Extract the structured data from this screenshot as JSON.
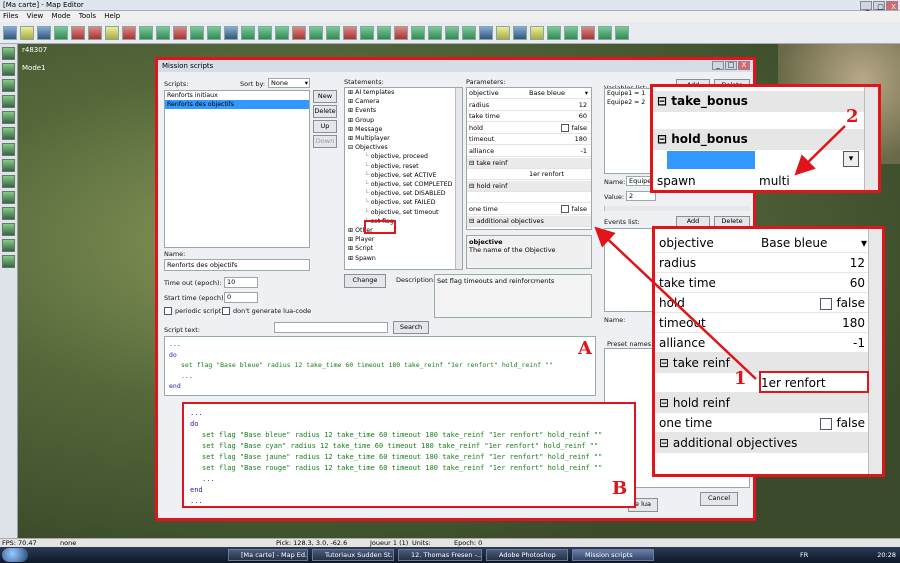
{
  "window": {
    "title": "[Ma carte] - Map Editor",
    "buttons": [
      "_",
      "□",
      "X"
    ]
  },
  "menu": [
    "Files",
    "View",
    "Mode",
    "Tools",
    "Help"
  ],
  "viewport": {
    "coords": "r48307",
    "mode": "Mode1"
  },
  "dialog": {
    "title": "Mission scripts",
    "scripts_label": "Scripts:",
    "sort_label": "Sort by:",
    "sort_value": "None",
    "scripts": [
      "Renforts initiaux",
      "Renforts des objectifs"
    ],
    "selected_script": 1,
    "script_buttons": {
      "new": "New",
      "delete": "Delete",
      "up": "Up",
      "down": "Down"
    },
    "name_label": "Name:",
    "name_value": "Renforts des objectifs",
    "timeout_label": "Time out (epoch):",
    "timeout_value": "10",
    "start_label": "Start time (epoch):",
    "start_value": "0",
    "periodic_label": "periodic script",
    "nolua_label": "don't generate lua-code",
    "script_text_label": "Script text:",
    "search_label": "Search",
    "statements_label": "Statements:",
    "tree": [
      {
        "label": "AI templates",
        "level": 0,
        "sign": "+"
      },
      {
        "label": "Camera",
        "level": 0,
        "sign": "+"
      },
      {
        "label": "Events",
        "level": 0,
        "sign": "+"
      },
      {
        "label": "Group",
        "level": 0,
        "sign": "+"
      },
      {
        "label": "Message",
        "level": 0,
        "sign": "+"
      },
      {
        "label": "Multiplayer",
        "level": 0,
        "sign": "+"
      },
      {
        "label": "Objectives",
        "level": 0,
        "sign": "-"
      },
      {
        "label": "objective, proceed",
        "level": 1
      },
      {
        "label": "objective, reset",
        "level": 1
      },
      {
        "label": "objective, set ACTIVE",
        "level": 1
      },
      {
        "label": "objective, set COMPLETED",
        "level": 1
      },
      {
        "label": "objective, set DISABLED",
        "level": 1
      },
      {
        "label": "objective, set FAILED",
        "level": 1
      },
      {
        "label": "objective, set timeout",
        "level": 1
      },
      {
        "label": "set flag",
        "level": 1
      },
      {
        "label": "Other",
        "level": 0,
        "sign": "+"
      },
      {
        "label": "Player",
        "level": 0,
        "sign": "+"
      },
      {
        "label": "Script",
        "level": 0,
        "sign": "+"
      },
      {
        "label": "Spawn",
        "level": 0,
        "sign": "+"
      }
    ],
    "change_label": "Change",
    "description_label": "Description:",
    "description_text": "Set flag timeouts and reinforcments",
    "parameters_label": "Parameters:",
    "params": [
      {
        "key": "objective",
        "value": "Base bleue",
        "align": "left",
        "dropdown": true
      },
      {
        "key": "radius",
        "value": "12"
      },
      {
        "key": "take time",
        "value": "60"
      },
      {
        "key": "hold",
        "value": "false",
        "checkbox": true
      },
      {
        "key": "timeout",
        "value": "180"
      },
      {
        "key": "alliance",
        "value": "-1"
      },
      {
        "key": "take reinf",
        "category": true
      },
      {
        "key": "",
        "value": "1er renfort",
        "align": "left"
      },
      {
        "key": "hold reinf",
        "category": true
      },
      {
        "key": "",
        "value": ""
      },
      {
        "key": "one time",
        "value": "false",
        "checkbox": true
      },
      {
        "key": "additional objectives",
        "category": true
      }
    ],
    "param_help_title": "objective",
    "param_help_text": "The name of the Objective",
    "variables_label": "Variables list:",
    "var_add": "Add",
    "var_delete": "Delete",
    "variables": [
      "Equipe1 = 1",
      "Equipe2 = 2"
    ],
    "var_name_label": "Name:",
    "var_name_value": "Equipe",
    "var_value_label": "Value:",
    "var_value_value": "2",
    "events_label": "Events list:",
    "ev_add": "Add",
    "ev_delete": "Delete",
    "name2_label": "Name:",
    "preset_label": "Preset names list",
    "lua_button": "e lua",
    "cancel_label": "Cancel",
    "code": [
      {
        "t": "...",
        "c": "kw",
        "i": 0
      },
      {
        "t": "do",
        "c": "kw",
        "i": 0
      },
      {
        "t": "set flag \"Base bleue\" radius 12 take_time 60 timeout 180 take_reinf \"1er renfort\" hold_reinf \"\"",
        "c": "st",
        "i": 1
      },
      {
        "t": "...",
        "c": "kw",
        "i": 1
      },
      {
        "t": "end",
        "c": "kw",
        "i": 0
      },
      {
        "t": "...",
        "c": "kw",
        "i": 0
      }
    ]
  },
  "annotation_b_code": [
    {
      "t": "...",
      "c": "kw",
      "i": 0
    },
    {
      "t": "do",
      "c": "kw",
      "i": 0
    },
    {
      "t": "set flag \"Base bleue\" radius 12 take_time 60 timeout 180 take_reinf \"1er renfort\" hold_reinf \"\"",
      "c": "st",
      "i": 1
    },
    {
      "t": "set flag \"Base cyan\" radius 12 take_time 60 timeout 180 take_reinf \"1er renfort\" hold_reinf \"\"",
      "c": "st",
      "i": 1
    },
    {
      "t": "set flag \"Base jaune\" radius 12 take_time 60 timeout 180 take_reinf \"1er renfort\" hold_reinf \"\"",
      "c": "st",
      "i": 1
    },
    {
      "t": "set flag \"Base rouge\" radius 12 take_time 60 timeout 180 take_reinf \"1er renfort\" hold_reinf \"\"",
      "c": "st",
      "i": 1
    },
    {
      "t": "...",
      "c": "kw",
      "i": 1
    },
    {
      "t": "end",
      "c": "kw",
      "i": 0
    },
    {
      "t": "...",
      "c": "kw",
      "i": 0
    }
  ],
  "annotations": {
    "a": "A",
    "b": "B",
    "one": "1",
    "two": "2"
  },
  "zoom1": [
    {
      "key": "objective",
      "value": "Base bleue",
      "align": "left",
      "dropdown": true
    },
    {
      "key": "radius",
      "value": "12"
    },
    {
      "key": "take time",
      "value": "60"
    },
    {
      "key": "hold",
      "value": "false",
      "checkbox": true
    },
    {
      "key": "timeout",
      "value": "180"
    },
    {
      "key": "alliance",
      "value": "-1"
    },
    {
      "key": "take reinf",
      "category": true
    },
    {
      "key": "",
      "value": "1er renfort",
      "align": "left"
    },
    {
      "key": "hold reinf",
      "category": true
    },
    {
      "key": "one time",
      "value": "false",
      "checkbox": true
    },
    {
      "key": "additional objectives",
      "category": true
    }
  ],
  "zoom2": {
    "take_bonus": "take_bonus",
    "hold_bonus": "hold_bonus",
    "spawn": "spawn",
    "multi": "multi"
  },
  "statusbar": {
    "fps": "FPS: 70.47",
    "none": "none",
    "pick": "Pick: 128.3, 3.0, -62.6",
    "joueur": "Joueur 1 (1)",
    "units": "Units:",
    "epoch": "Epoch: 0"
  },
  "taskbar": {
    "tasks": [
      "[Ma carte] - Map Ed...",
      "Tutoriaux Sudden St...",
      "12. Thomas Fresen -...",
      "Adobe Photoshop",
      "Mission scripts"
    ],
    "lang": "FR",
    "clock": "20:28"
  },
  "colors": {
    "annotation": "#e0141a",
    "selection": "#3399ff",
    "code_keyword": "#1a1acc",
    "code_string": "#18801a"
  }
}
